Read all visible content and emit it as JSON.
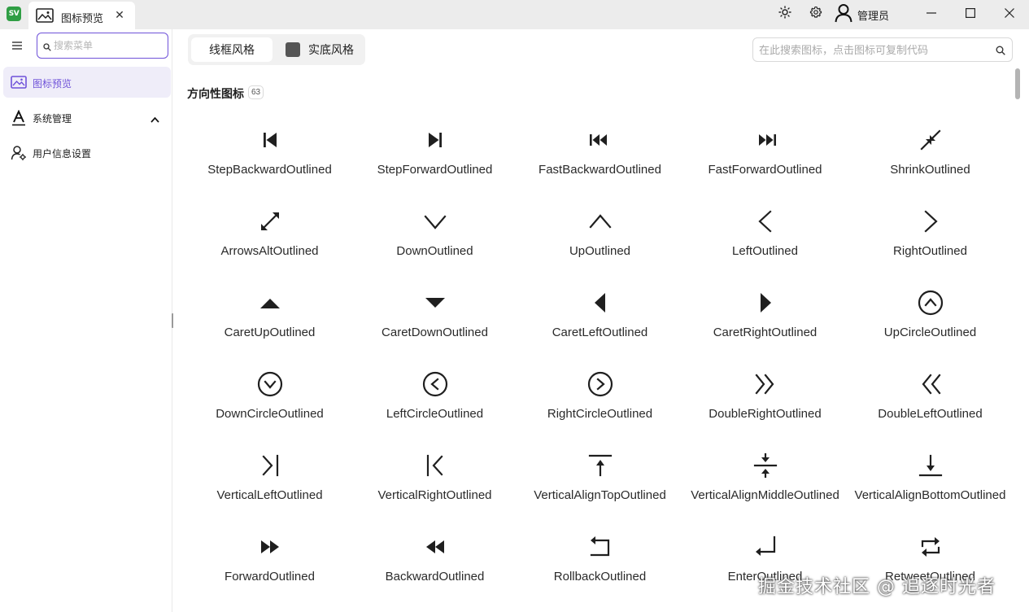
{
  "app": {
    "logo_text": "SV"
  },
  "tab": {
    "label": "图标预览",
    "icon": "image-icon",
    "close_label": "✕"
  },
  "titlebar": {
    "theme_icon": "sun-icon",
    "settings_icon": "gear-icon",
    "user_name": "管理员",
    "user_icon": "user-icon"
  },
  "sidebar": {
    "search_placeholder": "搜索菜单",
    "items": [
      {
        "label": "图标预览",
        "icon": "image-icon",
        "active": true
      },
      {
        "label": "系统管理",
        "icon": "letter-a-icon",
        "expanded": true
      },
      {
        "label": "用户信息设置",
        "icon": "user-settings-icon"
      }
    ]
  },
  "toolbar": {
    "style_outlined": "线框风格",
    "style_filled": "实底风格",
    "search_placeholder": "在此搜索图标，点击图标可复制代码"
  },
  "section": {
    "title": "方向性图标",
    "count": "63"
  },
  "icons": [
    "StepBackwardOutlined",
    "StepForwardOutlined",
    "FastBackwardOutlined",
    "FastForwardOutlined",
    "ShrinkOutlined",
    "ArrowsAltOutlined",
    "DownOutlined",
    "UpOutlined",
    "LeftOutlined",
    "RightOutlined",
    "CaretUpOutlined",
    "CaretDownOutlined",
    "CaretLeftOutlined",
    "CaretRightOutlined",
    "UpCircleOutlined",
    "DownCircleOutlined",
    "LeftCircleOutlined",
    "RightCircleOutlined",
    "DoubleRightOutlined",
    "DoubleLeftOutlined",
    "VerticalLeftOutlined",
    "VerticalRightOutlined",
    "VerticalAlignTopOutlined",
    "VerticalAlignMiddleOutlined",
    "VerticalAlignBottomOutlined",
    "ForwardOutlined",
    "BackwardOutlined",
    "RollbackOutlined",
    "EnterOutlined",
    "RetweetOutlined"
  ],
  "watermark": "掘金技术社区 @ 追逐时光者",
  "colors": {
    "accent": "#6f52d9",
    "active_bg": "#efedf9",
    "titlebar_bg": "#ececec",
    "icon": "#1f1f1f"
  }
}
